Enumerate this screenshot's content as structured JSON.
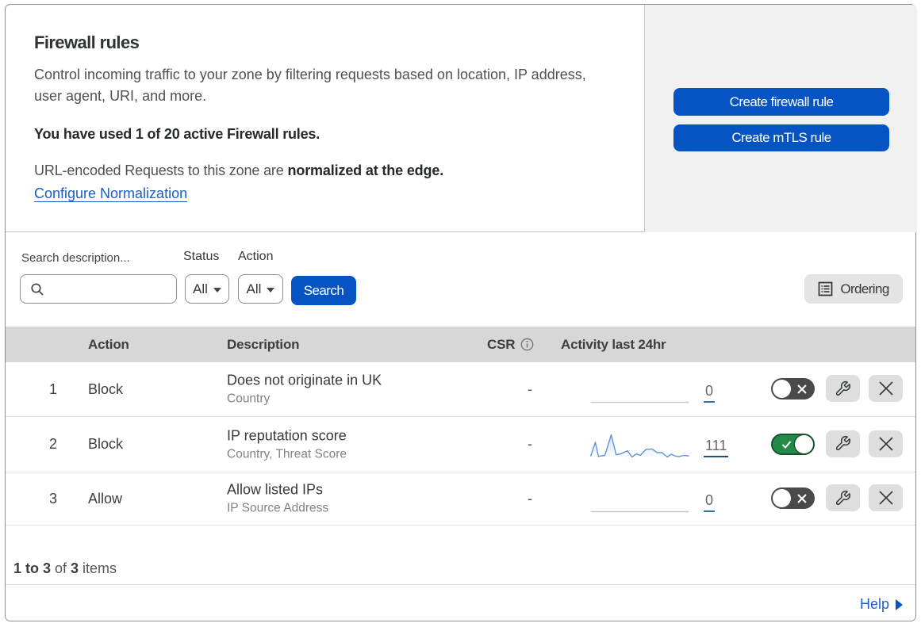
{
  "colors": {
    "accent_blue": "#0654c4",
    "link_blue": "#1b5ec4",
    "toggle_on_green": "#238a4a",
    "toggle_off_gray": "#4a4a4a",
    "sparkline_blue": "#6093de",
    "header_band_gray": "#d7d7d8",
    "panel_gray": "#f1f1f2"
  },
  "intro": {
    "title": "Firewall rules",
    "description": "Control incoming traffic to your zone by filtering requests based on location, IP address, user agent, URI, and more.",
    "usage": "You have used 1 of 20 active Firewall rules.",
    "normalization_text": "URL-encoded Requests to this zone are ",
    "normalization_bold": "normalized at the edge.",
    "normalization_link": "Configure Normalization",
    "buttons": [
      {
        "label": "Create firewall rule"
      },
      {
        "label": "Create mTLS rule"
      }
    ]
  },
  "filters": {
    "search_label": "Search description...",
    "search_value": "",
    "status_label": "Status",
    "status_value": "All",
    "action_label": "Action",
    "action_value": "All",
    "search_button": "Search",
    "ordering_button": "Ordering"
  },
  "table": {
    "columns": {
      "action": "Action",
      "description": "Description",
      "csr": "CSR",
      "activity": "Activity last 24hr"
    },
    "rows": [
      {
        "index": "1",
        "action": "Block",
        "description": "Does not originate in UK",
        "criteria": "Country",
        "csr": "-",
        "activity_count": "0",
        "enabled": false,
        "sparkline": null
      },
      {
        "index": "2",
        "action": "Block",
        "description": "IP reputation score",
        "criteria": "Country, Threat Score",
        "csr": "-",
        "activity_count": "111",
        "enabled": true,
        "sparkline": [
          [
            0,
            0.03
          ],
          [
            0.048,
            0.66
          ],
          [
            0.08,
            0.03
          ],
          [
            0.145,
            0.07
          ],
          [
            0.21,
            1.0
          ],
          [
            0.26,
            0.1
          ],
          [
            0.305,
            0.14
          ],
          [
            0.375,
            0.28
          ],
          [
            0.42,
            0.0
          ],
          [
            0.465,
            0.14
          ],
          [
            0.505,
            0.07
          ],
          [
            0.565,
            0.345
          ],
          [
            0.625,
            0.36
          ],
          [
            0.68,
            0.19
          ],
          [
            0.725,
            0.2
          ],
          [
            0.78,
            0.0
          ],
          [
            0.82,
            0.12
          ],
          [
            0.865,
            0.035
          ],
          [
            0.9,
            0.02
          ],
          [
            0.945,
            0.07
          ],
          [
            1.0,
            0.045
          ]
        ]
      },
      {
        "index": "3",
        "action": "Allow",
        "description": "Allow listed IPs",
        "criteria": "IP Source Address",
        "csr": "-",
        "activity_count": "0",
        "enabled": false,
        "sparkline": null
      }
    ]
  },
  "chart_data": {
    "type": "line",
    "title": "Activity last 24hr sparkline (rule 2)",
    "x": [
      0,
      0.048,
      0.08,
      0.145,
      0.21,
      0.26,
      0.305,
      0.375,
      0.42,
      0.465,
      0.505,
      0.565,
      0.625,
      0.68,
      0.725,
      0.78,
      0.82,
      0.865,
      0.9,
      0.945,
      1.0
    ],
    "values": [
      0.03,
      0.66,
      0.03,
      0.07,
      1.0,
      0.1,
      0.14,
      0.28,
      0.0,
      0.14,
      0.07,
      0.345,
      0.36,
      0.19,
      0.2,
      0.0,
      0.12,
      0.035,
      0.02,
      0.07,
      0.045
    ],
    "total": 111,
    "xlabel": "",
    "ylabel": ""
  },
  "footer": {
    "range_bold": "1 to 3",
    "of_text": " of ",
    "total_bold": "3",
    "items_text": " items",
    "help": "Help"
  }
}
